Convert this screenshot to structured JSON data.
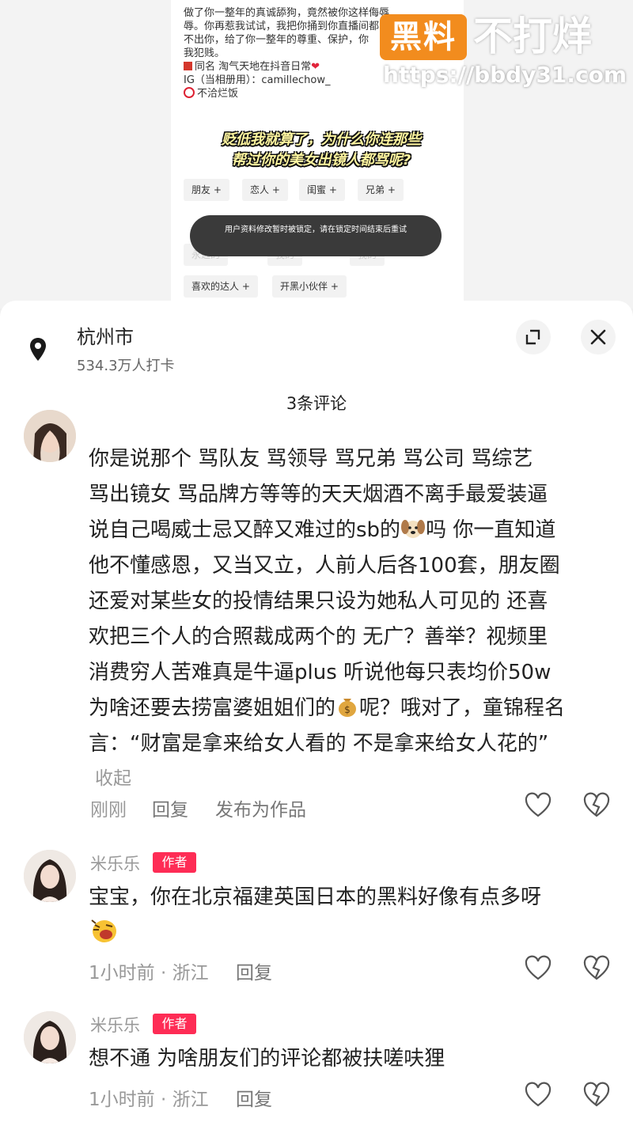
{
  "screenshot": {
    "bio_lines": [
      "做了你一整年的真诚舔狗，竟然被你这样侮辱",
      "辱。你再惹我试试，我把你捅到你直播间都",
      "不出你，给了你一整年的尊重、保护，你",
      "我犯贱。"
    ],
    "bio_samename_label": "同名  淘气天地在抖音日常",
    "bio_ig": "IG（当相册用）：camillechow_",
    "bio_last": "不洽烂饭",
    "caption_line1": "贬低我就算了，为什么你连那些",
    "caption_line2": "帮过你的美女出镜人都骂呢?",
    "tags": [
      "朋友 +",
      "恋人 +",
      "闺蜜 +",
      "兄弟 +",
      "喜欢的达人 +",
      "开黑小伙伴 +"
    ],
    "faded_tags": [
      "永远的",
      "我的",
      "我的"
    ],
    "toast": "用户资料修改暂时被锁定，请在锁定时间结束后重试"
  },
  "watermark": {
    "badge": "黑料",
    "slogan": "不打烊",
    "url": "https://bbdy31.com"
  },
  "location": {
    "name": "杭州市",
    "checkins": "534.3万人打卡"
  },
  "comments_header": "3条评论",
  "comments": [
    {
      "lines": [
        "你是说那个  骂队友  骂领导  骂兄弟  骂公司  骂综艺",
        "骂出镜女  骂品牌方等等的天天烟酒不离手最爱装逼",
        "说自己喝威士忌又醉又难过的sb的",
        "他不懂感恩，又当又立，人前人后各100套，朋友圈",
        "还爱对某些女的投情结果只设为她私人可见的  还喜",
        "欢把三个人的合照裁成两个的  无广？善举？视频里",
        "消费穷人苦难真是牛逼plus  听说他每只表均价50w",
        "为啥还要去捞富婆姐姐们的",
        "言：“财富是拿来给女人看的  不是拿来给女人花的”"
      ],
      "line3_suffix": "吗   你一直知道",
      "line8_suffix": "呢？哦对了，童锦程名",
      "collapse": "收起",
      "time": "刚刚",
      "reply": "回复",
      "publish": "发布为作品"
    },
    {
      "author": "米乐乐",
      "author_tag": "作者",
      "text": "宝宝，你在北京福建英国日本的黑料好像有点多呀",
      "time": "1小时前 · 浙江",
      "reply": "回复"
    },
    {
      "author": "米乐乐",
      "author_tag": "作者",
      "text": "想不通  为啥朋友们的评论都被扶嗟呋狸",
      "time": "1小时前 · 浙江",
      "reply": "回复"
    }
  ],
  "colors": {
    "author_tag": "#fe2c55",
    "watermark_orange": "#f28c1e"
  }
}
